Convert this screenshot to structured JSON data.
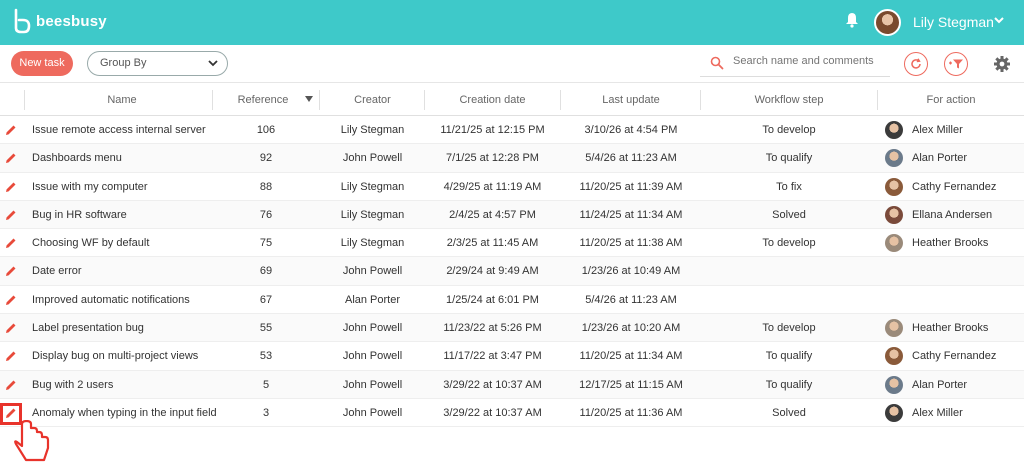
{
  "app": {
    "logo_text": "beesbusy",
    "user_name": "Lily Stegman",
    "accent": "#3ec9c9",
    "action_color": "#ee6a5e"
  },
  "toolbar": {
    "new_task_label": "New task",
    "group_by_label": "Group By",
    "search_placeholder": "Search name and comments"
  },
  "table": {
    "columns": {
      "name": "Name",
      "reference": "Reference",
      "creator": "Creator",
      "creation_date": "Creation date",
      "last_update": "Last update",
      "workflow_step": "Workflow step",
      "for_action": "For action"
    },
    "rows": [
      {
        "name": "Issue remote access internal server",
        "reference": "106",
        "creator": "Lily Stegman",
        "created": "11/21/25 at 12:15 PM",
        "updated": "3/10/26 at 4:54 PM",
        "step": "To develop",
        "action": "Alex Miller",
        "avatar": "#3b3b3b"
      },
      {
        "name": "Dashboards menu",
        "reference": "92",
        "creator": "John Powell",
        "created": "7/1/25 at 12:28 PM",
        "updated": "5/4/26 at 11:23 AM",
        "step": "To qualify",
        "action": "Alan Porter",
        "avatar": "#6b7a8a"
      },
      {
        "name": "Issue with my computer",
        "reference": "88",
        "creator": "Lily Stegman",
        "created": "4/29/25 at 11:19 AM",
        "updated": "11/20/25 at 11:39 AM",
        "step": "To fix",
        "action": "Cathy Fernandez",
        "avatar": "#8a5a3a"
      },
      {
        "name": "Bug in HR software",
        "reference": "76",
        "creator": "Lily Stegman",
        "created": "2/4/25 at 4:57 PM",
        "updated": "11/24/25 at 11:34 AM",
        "step": "Solved",
        "action": "Ellana Andersen",
        "avatar": "#7a4a3a"
      },
      {
        "name": "Choosing WF by default",
        "reference": "75",
        "creator": "Lily Stegman",
        "created": "2/3/25 at 11:45 AM",
        "updated": "11/20/25 at 11:38 AM",
        "step": "To develop",
        "action": "Heather Brooks",
        "avatar": "#9a8a7a"
      },
      {
        "name": "Date error",
        "reference": "69",
        "creator": "John Powell",
        "created": "2/29/24 at 9:49 AM",
        "updated": "1/23/26 at 10:49 AM",
        "step": "",
        "action": "",
        "avatar": ""
      },
      {
        "name": "Improved automatic notifications",
        "reference": "67",
        "creator": "Alan Porter",
        "created": "1/25/24 at 6:01 PM",
        "updated": "5/4/26 at 11:23 AM",
        "step": "",
        "action": "",
        "avatar": ""
      },
      {
        "name": "Label presentation bug",
        "reference": "55",
        "creator": "John Powell",
        "created": "11/23/22 at 5:26 PM",
        "updated": "1/23/26 at 10:20 AM",
        "step": "To develop",
        "action": "Heather Brooks",
        "avatar": "#9a8a7a"
      },
      {
        "name": "Display bug on multi-project views",
        "reference": "53",
        "creator": "John Powell",
        "created": "11/17/22 at 3:47 PM",
        "updated": "11/20/25 at 11:34 AM",
        "step": "To qualify",
        "action": "Cathy Fernandez",
        "avatar": "#8a5a3a"
      },
      {
        "name": "Bug with 2 users",
        "reference": "5",
        "creator": "John Powell",
        "created": "3/29/22 at 10:37 AM",
        "updated": "12/17/25 at 11:15 AM",
        "step": "To qualify",
        "action": "Alan Porter",
        "avatar": "#6b7a8a"
      },
      {
        "name": "Anomaly when typing in the input field",
        "reference": "3",
        "creator": "John Powell",
        "created": "3/29/22 at 10:37 AM",
        "updated": "11/20/25 at 11:36 AM",
        "step": "Solved",
        "action": "Alex Miller",
        "avatar": "#3b3b3b"
      }
    ]
  }
}
